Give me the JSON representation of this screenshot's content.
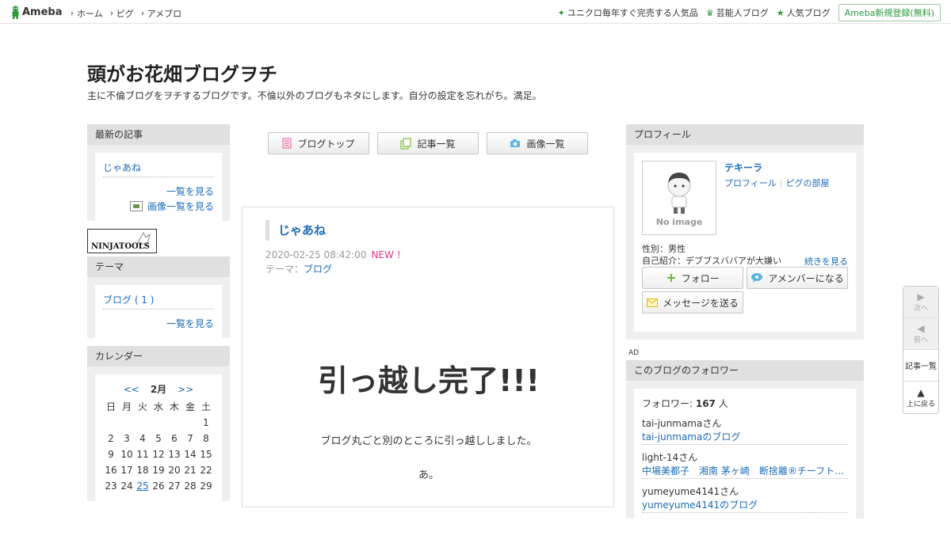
{
  "topbar": {
    "logo": "Ameba",
    "nav": [
      "ホーム",
      "ピグ",
      "アメブロ"
    ],
    "right": [
      {
        "icon": "sparkle-icon",
        "label": "ユニクロ毎年すぐ完売する人気品"
      },
      {
        "icon": "crown-icon",
        "label": "芸能人ブログ"
      },
      {
        "icon": "star-icon",
        "label": "人気ブログ"
      }
    ],
    "signup": "Ameba新規登録(無料)"
  },
  "header": {
    "title": "頭がお花畑ブログヲチ",
    "description": "主に不倫ブログをヲチするブログです。不倫以外のブログもネタにします。自分の設定を忘れがち。満足。"
  },
  "left": {
    "recent": {
      "heading": "最新の記事",
      "items": [
        "じゃあね"
      ],
      "more": "一覧を見る",
      "images": "画像一覧を見る"
    },
    "ninja": "NINJATOOLS",
    "theme": {
      "heading": "テーマ",
      "items": [
        "ブログ ( 1 )"
      ],
      "more": "一覧を見る"
    },
    "calendar": {
      "heading": "カレンダー",
      "prev": "<<",
      "month": "2月",
      "next": ">>",
      "weekdays": [
        "日",
        "月",
        "火",
        "水",
        "木",
        "金",
        "土"
      ],
      "rows": [
        [
          "",
          "",
          "",
          "",
          "",
          "",
          "1"
        ],
        [
          "2",
          "3",
          "4",
          "5",
          "6",
          "7",
          "8"
        ],
        [
          "9",
          "10",
          "11",
          "12",
          "13",
          "14",
          "15"
        ],
        [
          "16",
          "17",
          "18",
          "19",
          "20",
          "21",
          "22"
        ],
        [
          "23",
          "24",
          "25",
          "26",
          "27",
          "28",
          "29"
        ]
      ],
      "linked_day": "25"
    }
  },
  "center": {
    "buttons": [
      {
        "icon": "document-icon",
        "label": "ブログトップ"
      },
      {
        "icon": "copy-icon",
        "label": "記事一覧"
      },
      {
        "icon": "camera-icon",
        "label": "画像一覧"
      }
    ],
    "article": {
      "title": "じゃあね",
      "date": "2020-02-25 08:42:00",
      "new_label": "NEW !",
      "theme_label": "テーマ：",
      "theme": "ブログ",
      "headline": "引っ越し完了!!!",
      "paragraph1": "ブログ丸ごと別のところに引っ越ししました。",
      "paragraph2": "あ。"
    }
  },
  "right": {
    "profile": {
      "heading": "プロフィール",
      "no_image": "No image",
      "name": "テキーラ",
      "link_profile": "プロフィール",
      "link_room": "ピグの部屋",
      "gender": "性別：男性",
      "intro": "自己紹介：デブブスババアが大嫌い",
      "more": "続きを見る",
      "follow": "フォロー",
      "amember": "アメンバーになる",
      "message": "メッセージを送る"
    },
    "ad": "AD",
    "followers": {
      "heading": "このブログのフォロワー",
      "count_label": "フォロワー: ",
      "count": "167",
      "count_unit": " 人",
      "items": [
        {
          "name": "tai-junmamaさん",
          "blog": "tai-junmamaのブログ"
        },
        {
          "name": "light-14さん",
          "blog": "中場美都子　湘南 茅ヶ崎　断捨離®チーフトレーナー"
        },
        {
          "name": "yumeyume4141さん",
          "blog": "yumeyume4141のブログ"
        }
      ]
    }
  },
  "sidenav": {
    "next": "次へ",
    "prev": "前へ",
    "list": "記事一覧",
    "top": "上に戻る"
  }
}
